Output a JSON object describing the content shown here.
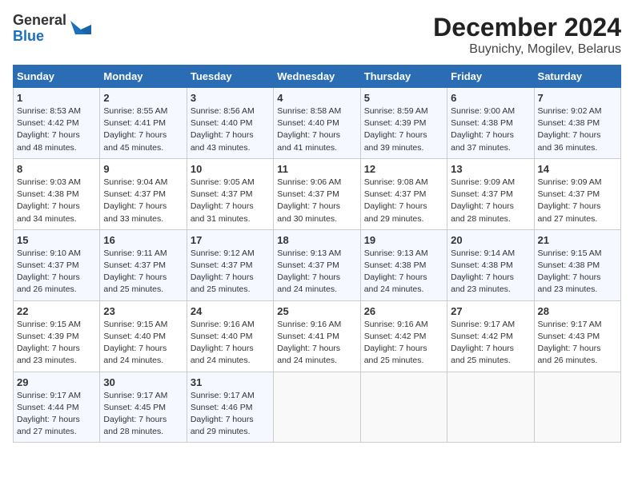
{
  "header": {
    "logo_line1": "General",
    "logo_line2": "Blue",
    "title": "December 2024",
    "subtitle": "Buynichy, Mogilev, Belarus"
  },
  "columns": [
    "Sunday",
    "Monday",
    "Tuesday",
    "Wednesday",
    "Thursday",
    "Friday",
    "Saturday"
  ],
  "weeks": [
    [
      {
        "day": "1",
        "info": "Sunrise: 8:53 AM\nSunset: 4:42 PM\nDaylight: 7 hours\nand 48 minutes."
      },
      {
        "day": "2",
        "info": "Sunrise: 8:55 AM\nSunset: 4:41 PM\nDaylight: 7 hours\nand 45 minutes."
      },
      {
        "day": "3",
        "info": "Sunrise: 8:56 AM\nSunset: 4:40 PM\nDaylight: 7 hours\nand 43 minutes."
      },
      {
        "day": "4",
        "info": "Sunrise: 8:58 AM\nSunset: 4:40 PM\nDaylight: 7 hours\nand 41 minutes."
      },
      {
        "day": "5",
        "info": "Sunrise: 8:59 AM\nSunset: 4:39 PM\nDaylight: 7 hours\nand 39 minutes."
      },
      {
        "day": "6",
        "info": "Sunrise: 9:00 AM\nSunset: 4:38 PM\nDaylight: 7 hours\nand 37 minutes."
      },
      {
        "day": "7",
        "info": "Sunrise: 9:02 AM\nSunset: 4:38 PM\nDaylight: 7 hours\nand 36 minutes."
      }
    ],
    [
      {
        "day": "8",
        "info": "Sunrise: 9:03 AM\nSunset: 4:38 PM\nDaylight: 7 hours\nand 34 minutes."
      },
      {
        "day": "9",
        "info": "Sunrise: 9:04 AM\nSunset: 4:37 PM\nDaylight: 7 hours\nand 33 minutes."
      },
      {
        "day": "10",
        "info": "Sunrise: 9:05 AM\nSunset: 4:37 PM\nDaylight: 7 hours\nand 31 minutes."
      },
      {
        "day": "11",
        "info": "Sunrise: 9:06 AM\nSunset: 4:37 PM\nDaylight: 7 hours\nand 30 minutes."
      },
      {
        "day": "12",
        "info": "Sunrise: 9:08 AM\nSunset: 4:37 PM\nDaylight: 7 hours\nand 29 minutes."
      },
      {
        "day": "13",
        "info": "Sunrise: 9:09 AM\nSunset: 4:37 PM\nDaylight: 7 hours\nand 28 minutes."
      },
      {
        "day": "14",
        "info": "Sunrise: 9:09 AM\nSunset: 4:37 PM\nDaylight: 7 hours\nand 27 minutes."
      }
    ],
    [
      {
        "day": "15",
        "info": "Sunrise: 9:10 AM\nSunset: 4:37 PM\nDaylight: 7 hours\nand 26 minutes."
      },
      {
        "day": "16",
        "info": "Sunrise: 9:11 AM\nSunset: 4:37 PM\nDaylight: 7 hours\nand 25 minutes."
      },
      {
        "day": "17",
        "info": "Sunrise: 9:12 AM\nSunset: 4:37 PM\nDaylight: 7 hours\nand 25 minutes."
      },
      {
        "day": "18",
        "info": "Sunrise: 9:13 AM\nSunset: 4:37 PM\nDaylight: 7 hours\nand 24 minutes."
      },
      {
        "day": "19",
        "info": "Sunrise: 9:13 AM\nSunset: 4:38 PM\nDaylight: 7 hours\nand 24 minutes."
      },
      {
        "day": "20",
        "info": "Sunrise: 9:14 AM\nSunset: 4:38 PM\nDaylight: 7 hours\nand 23 minutes."
      },
      {
        "day": "21",
        "info": "Sunrise: 9:15 AM\nSunset: 4:38 PM\nDaylight: 7 hours\nand 23 minutes."
      }
    ],
    [
      {
        "day": "22",
        "info": "Sunrise: 9:15 AM\nSunset: 4:39 PM\nDaylight: 7 hours\nand 23 minutes."
      },
      {
        "day": "23",
        "info": "Sunrise: 9:15 AM\nSunset: 4:40 PM\nDaylight: 7 hours\nand 24 minutes."
      },
      {
        "day": "24",
        "info": "Sunrise: 9:16 AM\nSunset: 4:40 PM\nDaylight: 7 hours\nand 24 minutes."
      },
      {
        "day": "25",
        "info": "Sunrise: 9:16 AM\nSunset: 4:41 PM\nDaylight: 7 hours\nand 24 minutes."
      },
      {
        "day": "26",
        "info": "Sunrise: 9:16 AM\nSunset: 4:42 PM\nDaylight: 7 hours\nand 25 minutes."
      },
      {
        "day": "27",
        "info": "Sunrise: 9:17 AM\nSunset: 4:42 PM\nDaylight: 7 hours\nand 25 minutes."
      },
      {
        "day": "28",
        "info": "Sunrise: 9:17 AM\nSunset: 4:43 PM\nDaylight: 7 hours\nand 26 minutes."
      }
    ],
    [
      {
        "day": "29",
        "info": "Sunrise: 9:17 AM\nSunset: 4:44 PM\nDaylight: 7 hours\nand 27 minutes."
      },
      {
        "day": "30",
        "info": "Sunrise: 9:17 AM\nSunset: 4:45 PM\nDaylight: 7 hours\nand 28 minutes."
      },
      {
        "day": "31",
        "info": "Sunrise: 9:17 AM\nSunset: 4:46 PM\nDaylight: 7 hours\nand 29 minutes."
      },
      null,
      null,
      null,
      null
    ]
  ]
}
